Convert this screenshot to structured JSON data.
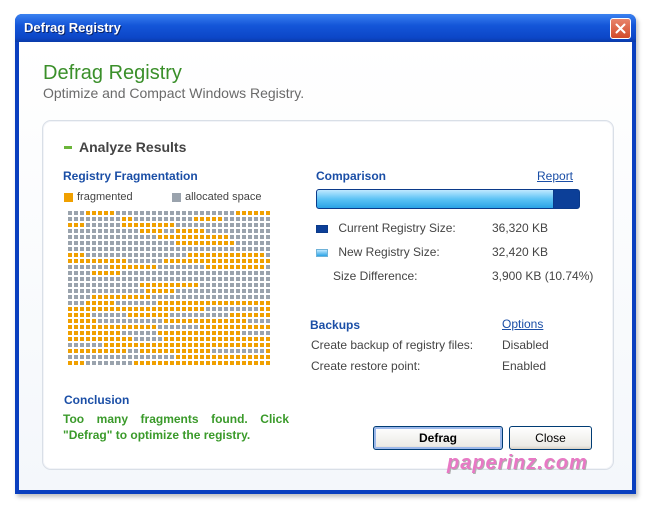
{
  "window": {
    "title": "Defrag Registry"
  },
  "header": {
    "title": "Defrag Registry",
    "subtitle": "Optimize and Compact Windows Registry."
  },
  "analyze": {
    "heading": "Analyze Results",
    "fragmentation": {
      "label": "Registry Fragmentation",
      "legend_fragmented": "fragmented",
      "legend_allocated": "allocated space",
      "fragmented_color": "#f0a000",
      "allocated_color": "#9aa3ad"
    },
    "conclusion": {
      "label": "Conclusion",
      "text": "Too many fragments found. Click \"Defrag\" to optimize the registry."
    },
    "comparison": {
      "label": "Comparison",
      "report_link": "Report",
      "progress_fraction": 0.9,
      "current_label": "Current Registry Size:",
      "current_value": "36,320 KB",
      "new_label": "New Registry Size:",
      "new_value": "32,420 KB",
      "diff_label": "Size Difference:",
      "diff_value": "3,900 KB (10.74%)"
    },
    "backups": {
      "label": "Backups",
      "options_link": "Options",
      "backup_label": "Create backup of registry files:",
      "backup_value": "Disabled",
      "restore_label": "Create restore point:",
      "restore_value": "Enabled"
    }
  },
  "buttons": {
    "defrag": "Defrag",
    "close": "Close"
  },
  "watermark": "paperinz.com",
  "icons": {
    "close": "close-icon",
    "current": "dark-blue-swatch-icon",
    "new": "light-blue-swatch-icon"
  }
}
